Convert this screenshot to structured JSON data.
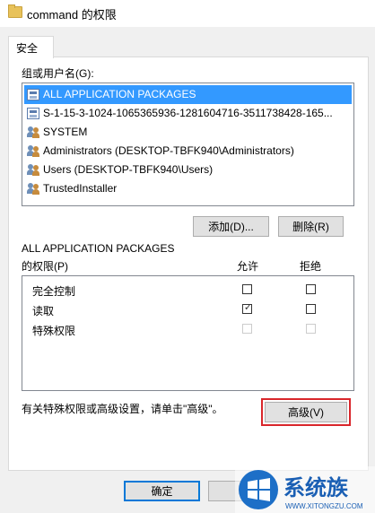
{
  "window": {
    "title": "command 的权限"
  },
  "tabs": [
    {
      "label": "安全"
    }
  ],
  "users_section": {
    "label": "组或用户名(G):",
    "items": [
      {
        "name": "ALL APPLICATION PACKAGES",
        "icon": "package-icon",
        "selected": true
      },
      {
        "name": "S-1-15-3-1024-1065365936-1281604716-3511738428-165...",
        "icon": "package-icon",
        "selected": false
      },
      {
        "name": "SYSTEM",
        "icon": "group-icon",
        "selected": false
      },
      {
        "name": "Administrators (DESKTOP-TBFK940\\Administrators)",
        "icon": "group-icon",
        "selected": false
      },
      {
        "name": "Users (DESKTOP-TBFK940\\Users)",
        "icon": "group-icon",
        "selected": false
      },
      {
        "name": "TrustedInstaller",
        "icon": "group-icon",
        "selected": false
      }
    ],
    "add_button": "添加(D)...",
    "remove_button": "删除(R)"
  },
  "permissions": {
    "heading": "ALL APPLICATION PACKAGES",
    "label": "的权限(P)",
    "allow_header": "允许",
    "deny_header": "拒绝",
    "rows": [
      {
        "name": "完全控制",
        "allow": false,
        "deny": false,
        "disabled": false
      },
      {
        "name": "读取",
        "allow": true,
        "deny": false,
        "disabled": false
      },
      {
        "name": "特殊权限",
        "allow": false,
        "deny": false,
        "disabled": true
      }
    ]
  },
  "advanced": {
    "hint": "有关特殊权限或高级设置，请单击\"高级\"。",
    "button": "高级(V)"
  },
  "footer": {
    "ok_button": "确定"
  },
  "watermark": {
    "brand": "系统族",
    "url": "WWW.XITONGZU.COM"
  },
  "colors": {
    "selection": "#3399ff",
    "highlight_border": "#d9262b",
    "dialog_bg": "#f0f0f0"
  }
}
